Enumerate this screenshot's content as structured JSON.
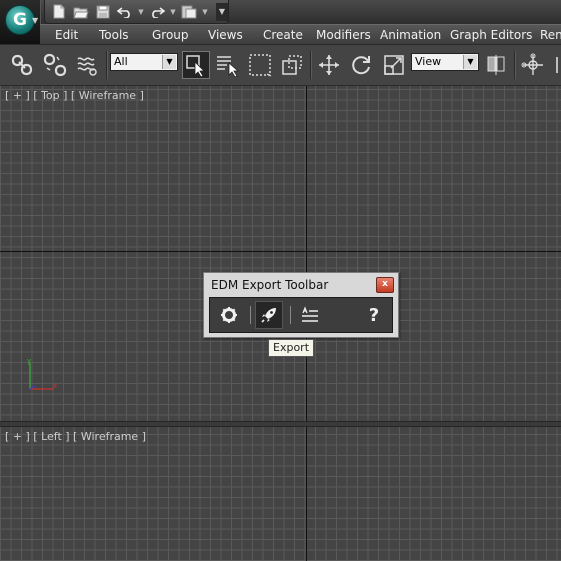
{
  "app": {
    "logo_letter": "G"
  },
  "menu": {
    "items": [
      "Edit",
      "Tools",
      "Group",
      "Views",
      "Create",
      "Modifiers",
      "Animation",
      "Graph Editors",
      "Ren"
    ]
  },
  "toolbar": {
    "selection_filter": "All",
    "reference_coord": "View"
  },
  "viewports": {
    "top": {
      "label": "[ + ] [ Top ] [ Wireframe ]"
    },
    "left": {
      "label": "[ + ] [ Left ] [ Wireframe ]"
    }
  },
  "edm_toolbar": {
    "title": "EDM Export Toolbar",
    "close_glyph": "x",
    "help_glyph": "?",
    "tooltip": "Export"
  },
  "colors": {
    "viewport_bg": "#444444",
    "grid": "#5a5a5a",
    "accent": "#1f8f88",
    "close": "#c23b22"
  },
  "icons": [
    "new-file-icon",
    "open-folder-icon",
    "save-icon",
    "undo-icon",
    "redo-icon",
    "project-icon",
    "link-icon",
    "unlink-icon",
    "bind-spacewarp-icon",
    "select-object-icon",
    "select-by-name-icon",
    "rect-selection-icon",
    "window-crossing-icon",
    "move-icon",
    "rotate-icon",
    "scale-icon",
    "pivot-icon",
    "mirror-icon",
    "gear-icon",
    "rocket-icon",
    "list-icon",
    "help-icon"
  ]
}
